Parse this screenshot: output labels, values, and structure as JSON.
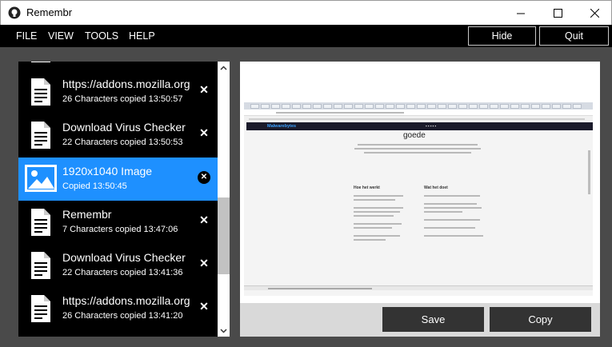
{
  "window": {
    "title": "Remembr",
    "icon": "app-logo-icon"
  },
  "menu": {
    "items": [
      "FILE",
      "VIEW",
      "TOOLS",
      "HELP"
    ],
    "hide_label": "Hide",
    "quit_label": "Quit"
  },
  "clips": [
    {
      "title": "https://addons.mozilla.org",
      "subtitle": "26 Characters copied 13:50:57",
      "icon": "document-icon",
      "selected": false
    },
    {
      "title": "Download Virus Checker",
      "subtitle": "22 Characters copied 13:50:53",
      "icon": "document-icon",
      "selected": false
    },
    {
      "title": "1920x1040 Image",
      "subtitle": "Copied 13:50:45",
      "icon": "image-icon",
      "selected": true
    },
    {
      "title": "Remembr",
      "subtitle": "7 Characters copied 13:47:06",
      "icon": "document-icon",
      "selected": false
    },
    {
      "title": "Download Virus Checker",
      "subtitle": "22 Characters copied 13:41:36",
      "icon": "document-icon",
      "selected": false
    },
    {
      "title": "https://addons.mozilla.org",
      "subtitle": "26 Characters copied 13:41:20",
      "icon": "document-icon",
      "selected": false
    }
  ],
  "preview": {
    "heading": "goede",
    "logo": "Malwarebytes",
    "col1": "Hoe het werkt",
    "col2": "Wat het doet"
  },
  "actions": {
    "save_label": "Save",
    "copy_label": "Copy"
  },
  "colors": {
    "selected": "#1e90ff",
    "list_bg": "#000000",
    "main_bg": "#4a4a4a"
  }
}
